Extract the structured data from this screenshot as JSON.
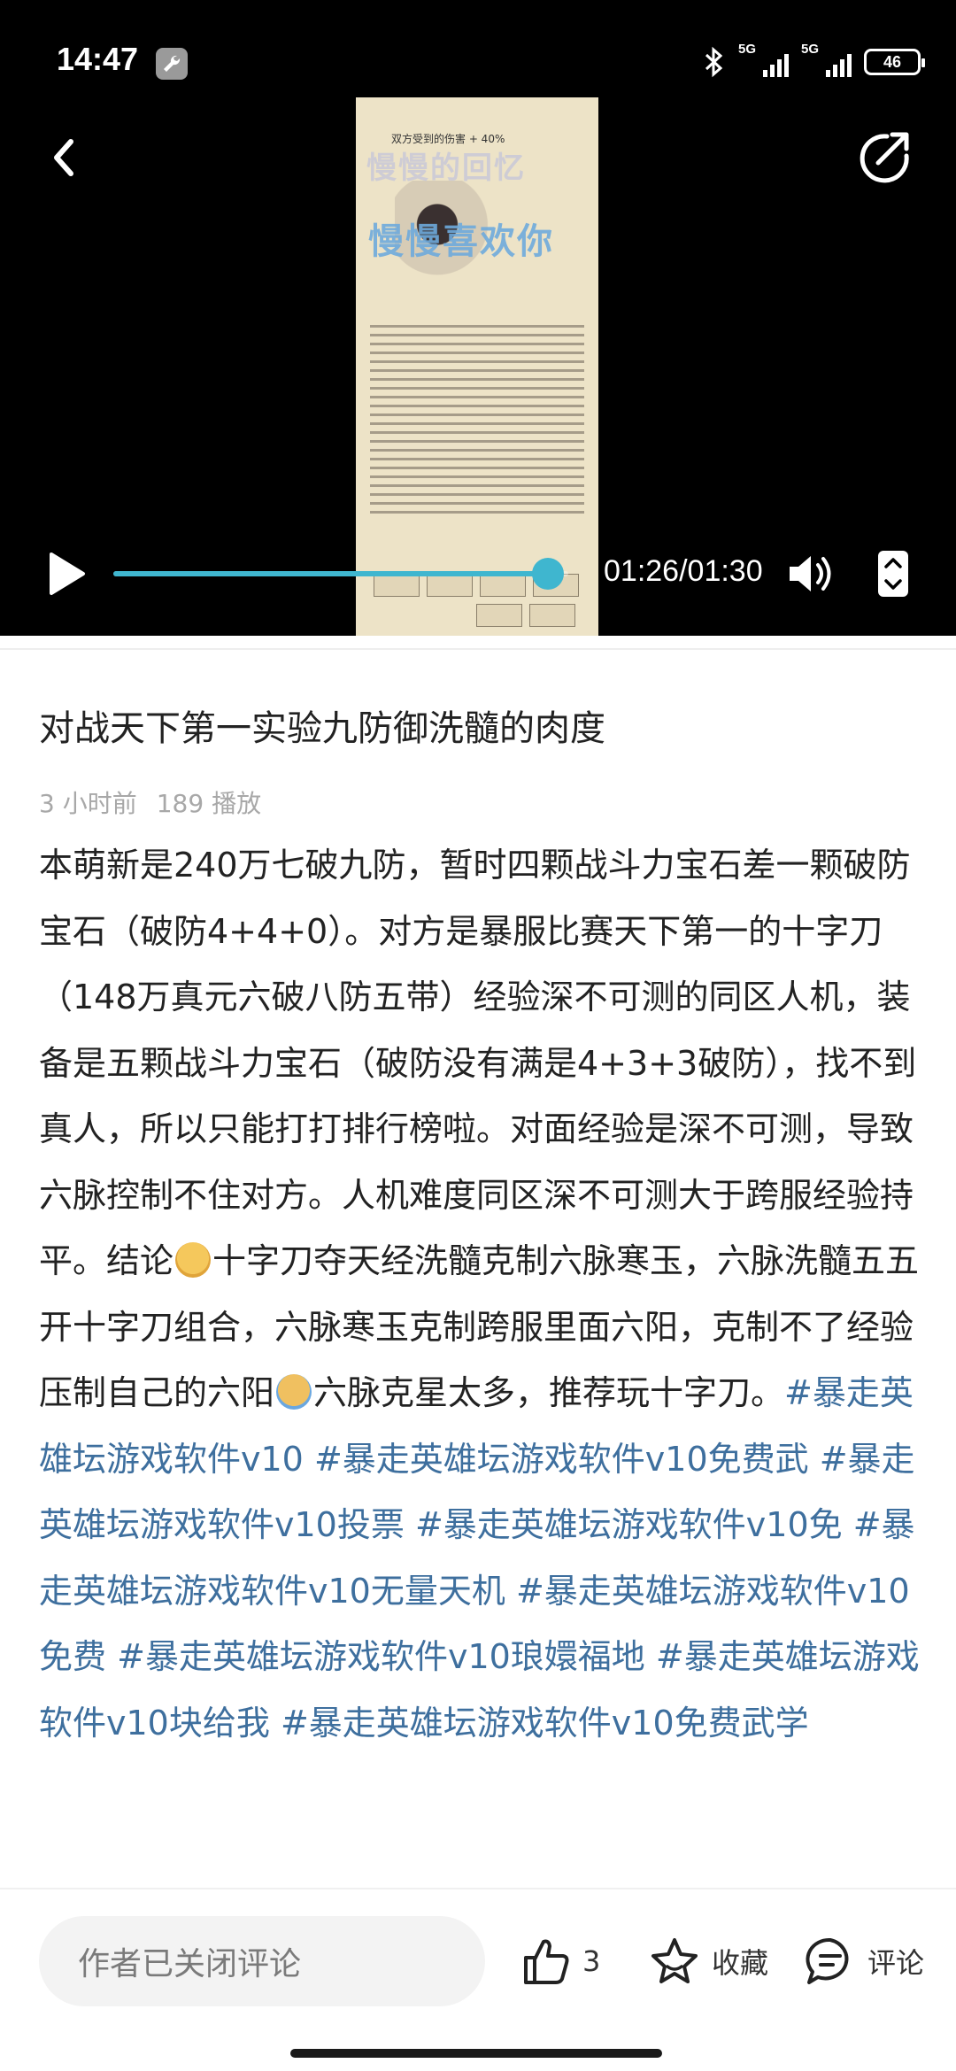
{
  "status_bar": {
    "time": "14:47",
    "network_1": "5G",
    "network_2": "5G",
    "battery": "46"
  },
  "video": {
    "frame_top_text": "双方受到的伤害 + 40%",
    "watermark_1": "慢慢的回忆",
    "watermark_2": "慢慢喜欢你",
    "time_label": "01:26/01:30",
    "progress": 0.956
  },
  "post": {
    "title": "对战天下第一实验九防御洗髓的肉度",
    "time_ago": "3 小时前",
    "plays": "189 播放",
    "body_part1": "本萌新是240万七破九防，暂时四颗战斗力宝石差一颗破防宝石（破防4+4+0）。对方是暴服比赛天下第一的十字刀（148万真元六破八防五带）经验深不可测的同区人机，装备是五颗战斗力宝石（破防没有满是4+3+3破防），找不到真人，所以只能打打排行榜啦。对面经验是深不可测，导致六脉控制不住对方。人机难度同区深不可测大于跨服经验持平。结论",
    "body_part2": "十字刀夺天经洗髓克制六脉寒玉，六脉洗髓五五开十字刀组合，六脉寒玉克制跨服里面六阳，克制不了经验压制自己的六阳",
    "body_part3": "六脉克星太多，推荐玩十字刀。",
    "tags": [
      "#暴走英雄坛游戏软件v10",
      "#暴走英雄坛游戏软件v10免费武",
      "#暴走英雄坛游戏软件v10投票",
      "#暴走英雄坛游戏软件v10免",
      "#暴走英雄坛游戏软件v10无量天机",
      "#暴走英雄坛游戏软件v10免费",
      "#暴走英雄坛游戏软件v10琅嬛福地",
      "#暴走英雄坛游戏软件v10块给我",
      "#暴走英雄坛游戏软件v10免费武学"
    ]
  },
  "bottom_bar": {
    "comment_placeholder": "作者已关闭评论",
    "like_count": "3",
    "favorite_label": "收藏",
    "comment_label": "评论"
  },
  "colors": {
    "accent": "#3fb6cf",
    "tag": "#3e6f9e"
  }
}
